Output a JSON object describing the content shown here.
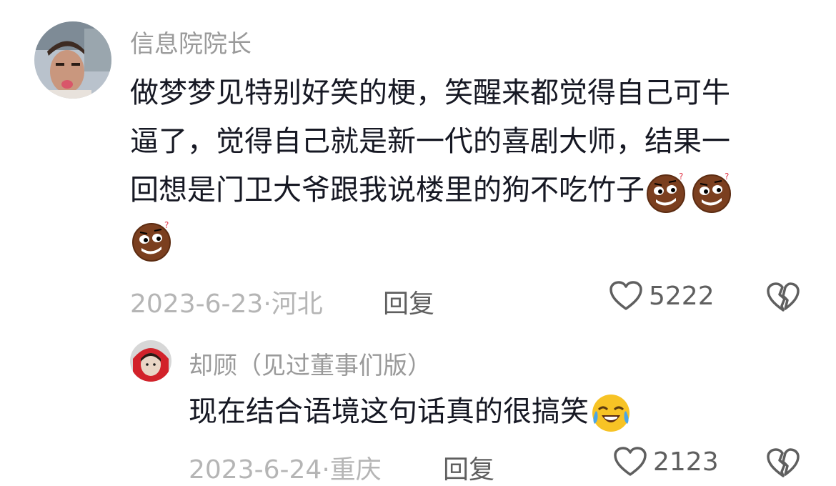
{
  "comments": [
    {
      "username": "信息院院长",
      "text_line1": "做梦梦见特别好笑的梗，笑醒来都觉得自己可牛",
      "text_line2": "逼了，觉得自己就是新一代的喜剧大师，结果一",
      "text_line3": "回想是门卫大爷跟我说楼里的狗不吃竹子",
      "emoji": "confused-face-emoji",
      "date": "2023-6-23",
      "location": "河北",
      "reply_label": "回复",
      "like_count": "5222"
    },
    {
      "username": "却顾（见过董事们版）",
      "text": "现在结合语境这句话真的很搞笑",
      "emoji": "crying-laughing-emoji",
      "date": "2023-6-24",
      "location": "重庆",
      "reply_label": "回复",
      "like_count": "2123"
    }
  ],
  "icons": {
    "like": "heart-outline-icon",
    "dislike": "broken-heart-icon"
  },
  "colors": {
    "username": "#9a9a9a",
    "meta": "#b5b5b5",
    "action": "#5f5f5f"
  }
}
